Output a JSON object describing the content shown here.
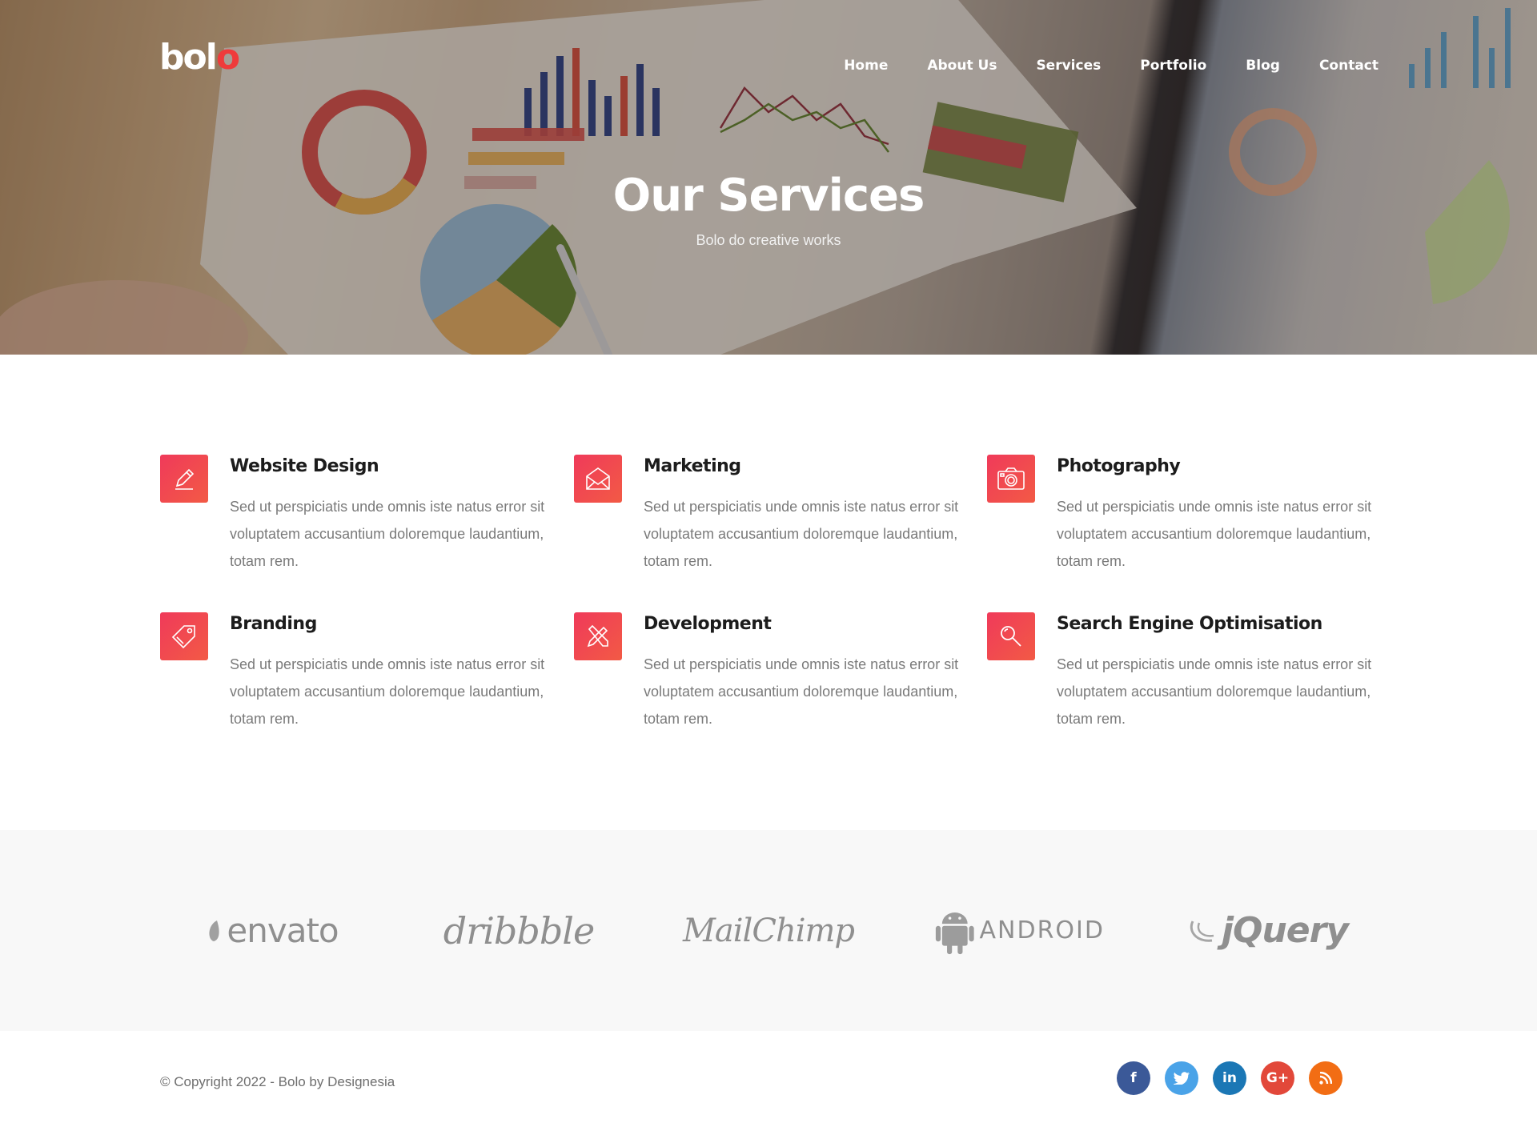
{
  "brand": {
    "logo_main": "bol",
    "logo_accent": "o",
    "accent_color": "#ef3b3b"
  },
  "nav": {
    "items": [
      {
        "label": "Home"
      },
      {
        "label": "About Us"
      },
      {
        "label": "Services"
      },
      {
        "label": "Portfolio"
      },
      {
        "label": "Blog"
      },
      {
        "label": "Contact"
      }
    ]
  },
  "hero": {
    "title": "Our Services",
    "subtitle": "Bolo do creative works"
  },
  "services": [
    {
      "title": "Website Design",
      "icon": "pencil-icon",
      "text": "Sed ut perspiciatis unde omnis iste natus error sit voluptatem accusantium doloremque laudantium, totam rem."
    },
    {
      "title": "Marketing",
      "icon": "envelope-icon",
      "text": "Sed ut perspiciatis unde omnis iste natus error sit voluptatem accusantium doloremque laudantium, totam rem."
    },
    {
      "title": "Photography",
      "icon": "camera-icon",
      "text": "Sed ut perspiciatis unde omnis iste natus error sit voluptatem accusantium doloremque laudantium, totam rem."
    },
    {
      "title": "Branding",
      "icon": "tag-icon",
      "text": "Sed ut perspiciatis unde omnis iste natus error sit voluptatem accusantium doloremque laudantium, totam rem."
    },
    {
      "title": "Development",
      "icon": "tools-icon",
      "text": "Sed ut perspiciatis unde omnis iste natus error sit voluptatem accusantium doloremque laudantium, totam rem."
    },
    {
      "title": "Search Engine Optimisation",
      "icon": "search-icon",
      "text": "Sed ut perspiciatis unde omnis iste natus error sit voluptatem accusantium doloremque laudantium, totam rem."
    }
  ],
  "partners": [
    "envato",
    "dribbble",
    "MailChimp",
    "android",
    "jQuery"
  ],
  "footer": {
    "copyright": "© Copyright 2022 - Bolo by Designesia",
    "socials": [
      {
        "name": "facebook-icon",
        "glyph": "f",
        "color": "#3b5998"
      },
      {
        "name": "twitter-icon",
        "glyph": "t",
        "color": "#4aa3e8"
      },
      {
        "name": "linkedin-icon",
        "glyph": "in",
        "color": "#1b77b5"
      },
      {
        "name": "google-plus-icon",
        "glyph": "G+",
        "color": "#e2483a"
      },
      {
        "name": "rss-icon",
        "glyph": "rss",
        "color": "#f26d14"
      }
    ]
  }
}
